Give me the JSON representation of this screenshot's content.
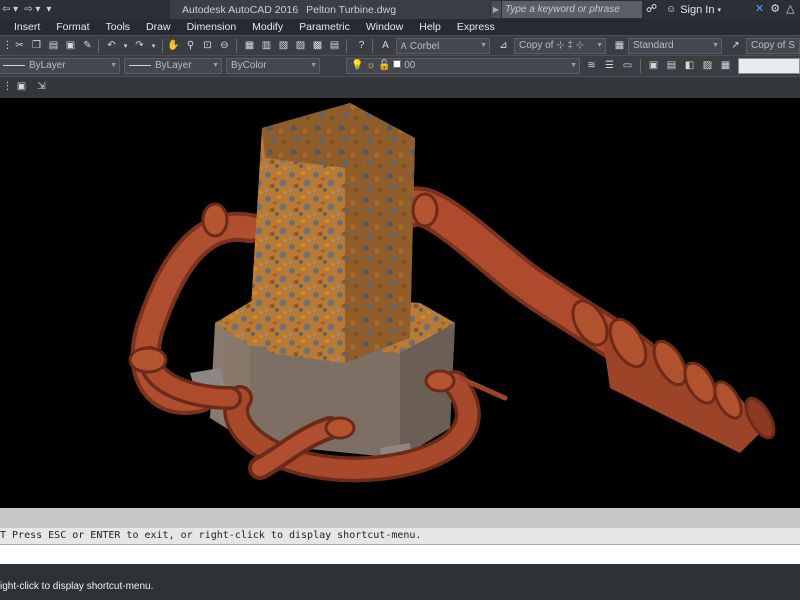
{
  "titlebar": {
    "qat_left": "⇦ ▾",
    "qat_mid": "⇨ ▾",
    "qat_more": "▾",
    "app": "Autodesk AutoCAD 2016",
    "document": "Pelton Turbine.dwg",
    "search_placeholder": "Type a keyword or phrase",
    "signin": "Sign In"
  },
  "menus": [
    "Insert",
    "Format",
    "Tools",
    "Draw",
    "Dimension",
    "Modify",
    "Parametric",
    "Window",
    "Help",
    "Express"
  ],
  "toolbar_styles": {
    "text_style": "Corbel",
    "text_style_copy": "Copy of",
    "dim_style": "Standard",
    "copy_of_right": "Copy of S"
  },
  "properties": {
    "linetype": "ByLayer",
    "lineweight": "ByLayer",
    "color": "ByColor",
    "layer": "00"
  },
  "command": {
    "history_line": "T Press ESC or ENTER to exit, or right-click to display shortcut-menu.",
    "tooltip": "ight-click to display shortcut-menu."
  },
  "colors": {
    "viewport_bg": "#000000",
    "pipe": "#a94a2a",
    "rust_orange": "#c07a2a",
    "housing": "#7a6a5e"
  }
}
